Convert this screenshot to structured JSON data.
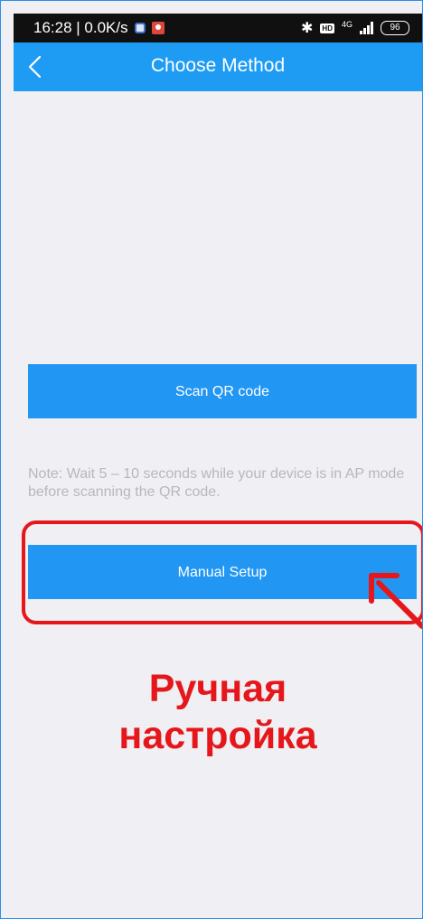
{
  "status_bar": {
    "time_speed": "16:28 | 0.0K/s",
    "network_label": "4G",
    "hd_label": "HD",
    "battery": "96"
  },
  "nav": {
    "title": "Choose Method",
    "back_icon": "chevron-left-icon"
  },
  "main": {
    "scan_button_label": "Scan QR code",
    "note": "Note: Wait 5 – 10 seconds while your device is in AP mode before scanning the QR code.",
    "manual_button_label": "Manual Setup"
  },
  "annotation": {
    "text_line1": "Ручная",
    "text_line2": "настройка",
    "color": "#e5171b"
  },
  "colors": {
    "nav_bar": "#1e9cf4",
    "button": "#2196f3",
    "background": "#efeff4"
  }
}
